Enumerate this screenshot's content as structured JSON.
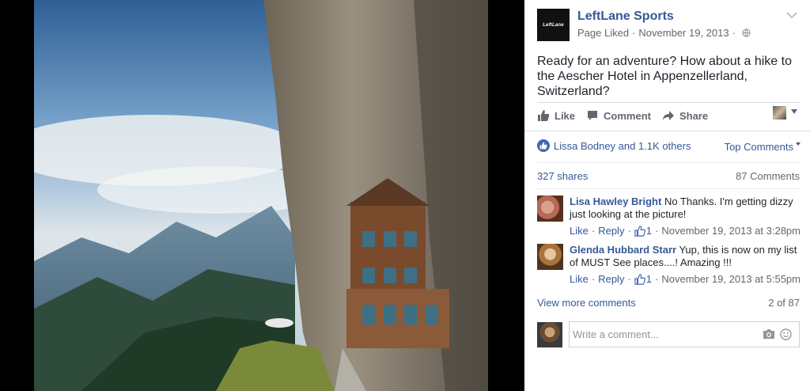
{
  "post": {
    "page_name": "LeftLane Sports",
    "logo_text": "LeftLane",
    "page_status": "Page Liked",
    "date": "November 19, 2013",
    "text": "Ready for an adventure? How about a hike to the Aescher Hotel in Appenzellerland, Switzerland?"
  },
  "actions": {
    "like": "Like",
    "comment": "Comment",
    "share": "Share"
  },
  "reactions": {
    "summary": "Lissa Bodney and 1.1K others",
    "sort_label": "Top Comments"
  },
  "stats": {
    "shares": "327 shares",
    "comments": "87 Comments"
  },
  "comments": [
    {
      "author": "Lisa Hawley Bright",
      "text": "No Thanks. I'm getting dizzy just looking at the picture!",
      "like": "Like",
      "reply": "Reply",
      "likes": "1",
      "timestamp": "November 19, 2013 at 3:28pm"
    },
    {
      "author": "Glenda Hubbard Starr",
      "text": "Yup, this is now on my list of MUST See places....! Amazing !!!",
      "like": "Like",
      "reply": "Reply",
      "likes": "1",
      "timestamp": "November 19, 2013 at 5:55pm"
    }
  ],
  "footer": {
    "view_more": "View more comments",
    "pager": "2 of 87",
    "placeholder": "Write a comment..."
  },
  "colors": {
    "link": "#365899",
    "like_badge": "#4267b2",
    "muted": "#616770"
  },
  "icons": [
    "globe-icon",
    "chevron-down-icon",
    "like-icon",
    "comment-icon",
    "share-icon",
    "camera-icon",
    "emoji-icon",
    "thumbs-up-icon"
  ]
}
